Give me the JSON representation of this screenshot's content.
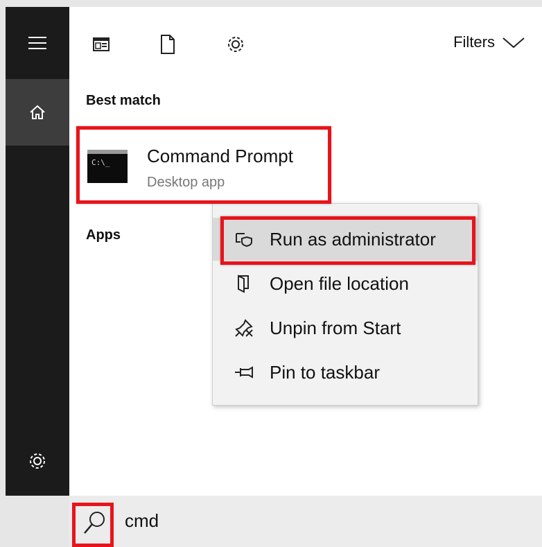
{
  "toolbar": {
    "icons": [
      "app-layout-icon",
      "document-icon",
      "gear-icon"
    ],
    "filters_label": "Filters"
  },
  "rail": {
    "icons": [
      "hamburger-icon",
      "home-icon",
      "gear-icon"
    ]
  },
  "best_match": {
    "heading": "Best match",
    "title": "Command Prompt",
    "subtitle": "Desktop app",
    "icon_text": "C:\\_"
  },
  "apps": {
    "heading": "Apps"
  },
  "context_menu": {
    "items": [
      {
        "label": "Run as administrator",
        "icon": "shield-window-icon"
      },
      {
        "label": "Open file location",
        "icon": "folder-icon"
      },
      {
        "label": "Unpin from Start",
        "icon": "unpin-icon"
      },
      {
        "label": "Pin to taskbar",
        "icon": "pin-icon"
      }
    ]
  },
  "search": {
    "value": "cmd"
  },
  "colors": {
    "annotation": "#e8141b",
    "rail": "#1b1b1b",
    "rail_active": "#3d3d3d"
  }
}
